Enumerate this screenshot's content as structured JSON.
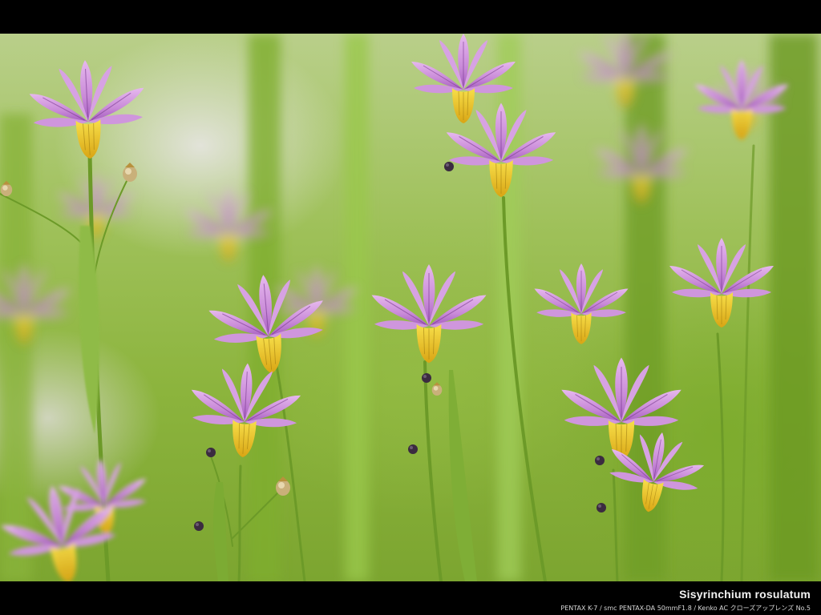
{
  "photo": {
    "subject": "flower-photo",
    "colors": {
      "petal": "#c98ad8",
      "petal_vein": "#7a3b8f",
      "throat": "#f2c81e",
      "foliage": "#8cb43d"
    }
  },
  "caption": {
    "title": "Sisyrinchium rosulatum",
    "equipment": "PENTAX K-7 / smc PENTAX-DA 50mmF1.8 / Kenko AC クローズアップレンズ No.5"
  }
}
